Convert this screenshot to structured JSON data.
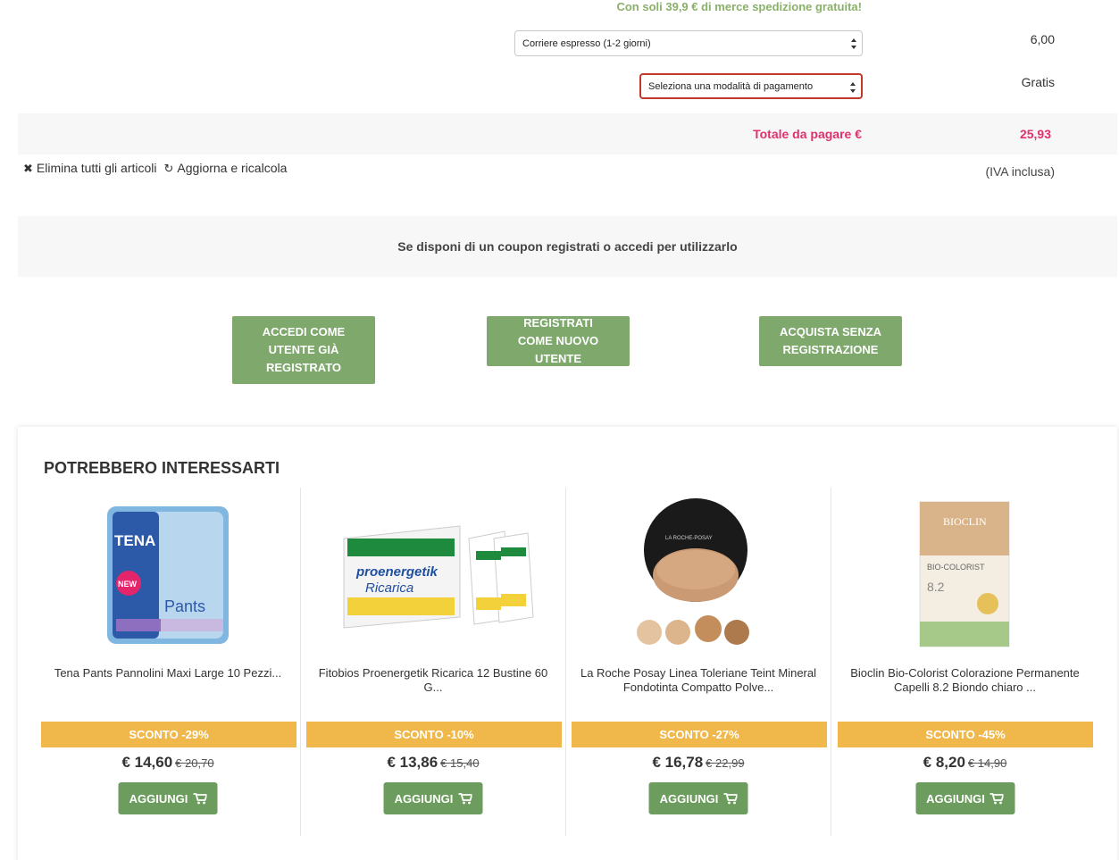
{
  "shipping": {
    "free_shipping_note": "Con soli 39,9 € di merce spedizione gratuita!",
    "carrier_selected": "Corriere espresso (1-2 giorni)",
    "carrier_cost": "6,00",
    "payment_selected": "Seleziona una modalità di pagamento",
    "payment_cost": "Gratis"
  },
  "total": {
    "label": "Totale da pagare €",
    "value": "25,93",
    "vat_note": "(IVA inclusa)"
  },
  "cart_actions": {
    "remove_all": "Elimina tutti gli articoli",
    "update": "Aggiorna e ricalcola"
  },
  "coupon": {
    "message": "Se disponi di un coupon registrati o accedi per utilizzarlo"
  },
  "checkout_buttons": {
    "login": "ACCEDI COME UTENTE GIÀ REGISTRATO",
    "register": "REGISTRATI COME NUOVO UTENTE",
    "guest": "ACQUISTA SENZA REGISTRAZIONE"
  },
  "recommendations": {
    "title": "POTREBBERO INTERESSARTI",
    "add_label": "AGGIUNGI",
    "products": [
      {
        "name": "Tena Pants Pannolini Maxi Large 10 Pezzi...",
        "discount": "SCONTO -29%",
        "price": "€ 14,60",
        "old_price": "€ 20,70",
        "brand": "TENA",
        "product_label": "Pants"
      },
      {
        "name": "Fitobios Proenergetik Ricarica 12 Bustine 60 G...",
        "discount": "SCONTO -10%",
        "price": "€ 13,86",
        "old_price": "€ 15,40",
        "brand": "proenergetik",
        "product_label": "Ricarica"
      },
      {
        "name": "La Roche Posay Linea Toleriane Teint Mineral Fondotinta Compatto Polve...",
        "discount": "SCONTO -27%",
        "price": "€ 16,78",
        "old_price": "€ 22,99",
        "brand": "LA ROCHE-POSAY"
      },
      {
        "name": "Bioclin Bio-Colorist Colorazione Permanente Capelli 8.2 Biondo chiaro ...",
        "discount": "SCONTO -45%",
        "price": "€ 8,20",
        "old_price": "€ 14,90",
        "brand": "BIOCLIN",
        "product_label": "BIO-COLORIST",
        "shade": "8.2"
      }
    ]
  },
  "colors": {
    "accent_green": "#7ea86c",
    "total_pink": "#e0306e",
    "discount_orange": "#f0b84b"
  }
}
